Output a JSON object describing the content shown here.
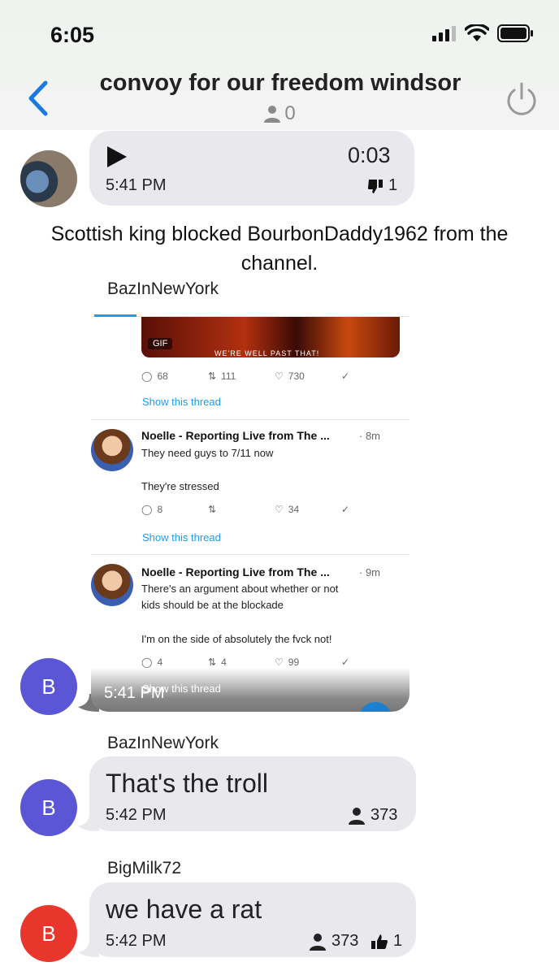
{
  "status": {
    "time": "6:05"
  },
  "header": {
    "title": "convoy for our freedom windsor",
    "member_count": "0"
  },
  "voice_message": {
    "duration": "0:03",
    "time": "5:41 PM",
    "dislike_count": "1"
  },
  "system_message": "Scottish king blocked BourbonDaddy1962 from the channel.",
  "image_message": {
    "sender": "BazInNewYork",
    "avatar_letter": "B",
    "time": "5:41 PM",
    "screenshot": {
      "gif_badge": "GIF",
      "gif_caption": "WE'RE WELL PAST THAT!",
      "tweet0_counts": {
        "replies": "68",
        "retweets": "111",
        "likes": "730"
      },
      "show_thread": "Show this thread",
      "tweets": [
        {
          "name": "Noelle - Reporting Live from The ...",
          "age": "· 8m",
          "line1": "They need guys to 7/11 now",
          "line2": "They're stressed",
          "replies": "8",
          "retweets": "",
          "likes": "34"
        },
        {
          "name": "Noelle - Reporting Live from The ...",
          "age": "· 9m",
          "line1": "There's an argument about whether or not",
          "line1b": "kids should be at the blockade",
          "line2": "I'm on the side of absolutely the fvck not!",
          "replies": "4",
          "retweets": "4",
          "likes": "99"
        }
      ]
    }
  },
  "messages": [
    {
      "sender": "BazInNewYork",
      "avatar_letter": "B",
      "text": "That's the troll",
      "time": "5:42 PM",
      "seen_count": "373"
    },
    {
      "sender": "BigMilk72",
      "avatar_letter": "B",
      "text": "we have a rat",
      "time": "5:42 PM",
      "seen_count": "373",
      "like_count": "1"
    }
  ],
  "colors": {
    "accent": "#1a7ae0",
    "bubble": "#e8e8ed",
    "avatar_purple": "#5a56d6",
    "avatar_red": "#e8362c"
  }
}
